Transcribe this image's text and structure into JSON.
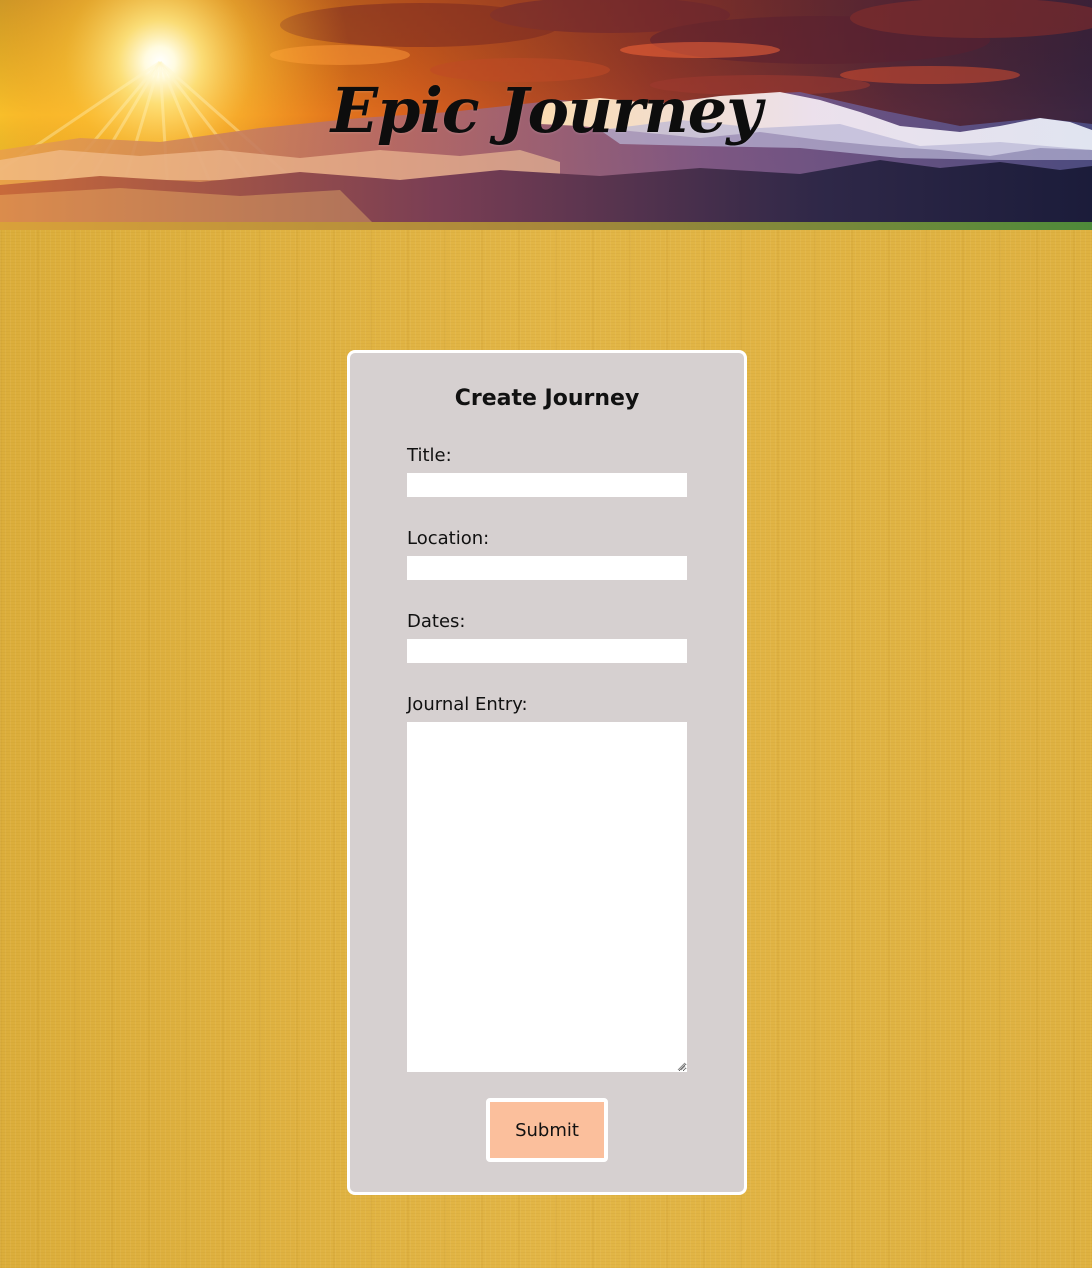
{
  "header": {
    "site_title": "Epic Journey"
  },
  "form": {
    "title": "Create Journey",
    "fields": [
      {
        "label": "Title:",
        "value": ""
      },
      {
        "label": "Location:",
        "value": ""
      },
      {
        "label": "Dates:",
        "value": ""
      },
      {
        "label": "Journal Entry:",
        "value": ""
      }
    ],
    "submit_label": "Submit"
  },
  "colors": {
    "page_background": "#e0b443",
    "card_background": "#d6d0d0",
    "card_border": "#ffffff",
    "submit_background": "#fbbf9c",
    "title_text": "#0d0d0d"
  }
}
